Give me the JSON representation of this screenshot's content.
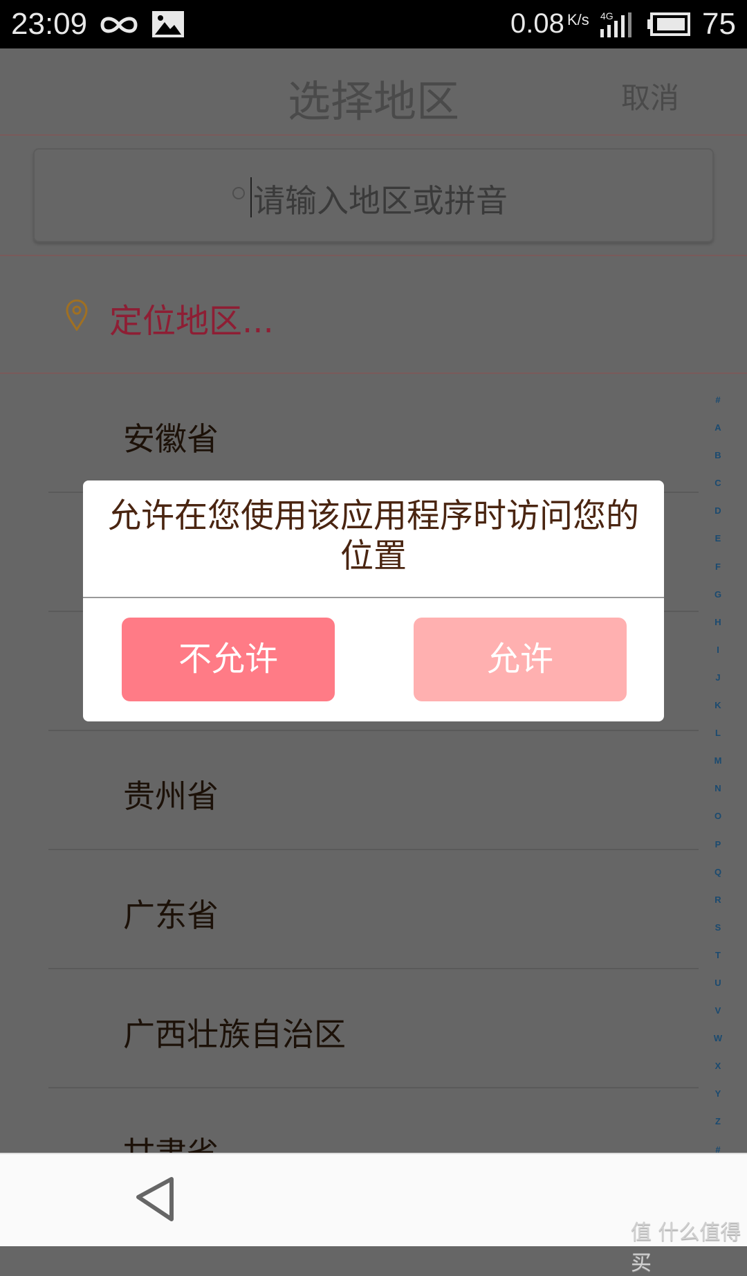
{
  "status_bar": {
    "time": "23:09",
    "speed": "0.08",
    "speed_unit": "K/s",
    "network": "4G",
    "battery": "75"
  },
  "header": {
    "title": "选择地区",
    "cancel_label": "取消"
  },
  "search": {
    "placeholder": "请输入地区或拼音"
  },
  "location": {
    "label": "定位地区..."
  },
  "regions": [
    "安徽省",
    "",
    "",
    "贵州省",
    "广东省",
    "广西壮族自治区",
    "甘肃省"
  ],
  "index_letters": [
    "#",
    "A",
    "B",
    "C",
    "D",
    "E",
    "F",
    "G",
    "H",
    "I",
    "J",
    "K",
    "L",
    "M",
    "N",
    "O",
    "P",
    "Q",
    "R",
    "S",
    "T",
    "U",
    "V",
    "W",
    "X",
    "Y",
    "Z",
    "#"
  ],
  "dialog": {
    "message": "允许在您使用该应用程序时访问您的位置",
    "deny_label": "不允许",
    "allow_label": "允许"
  },
  "colors": {
    "deny": "#ff7b86",
    "allow": "#ffb0b0",
    "location_text": "#d0304e",
    "message_text": "#4a2511"
  },
  "watermark": "值 什么值得买"
}
